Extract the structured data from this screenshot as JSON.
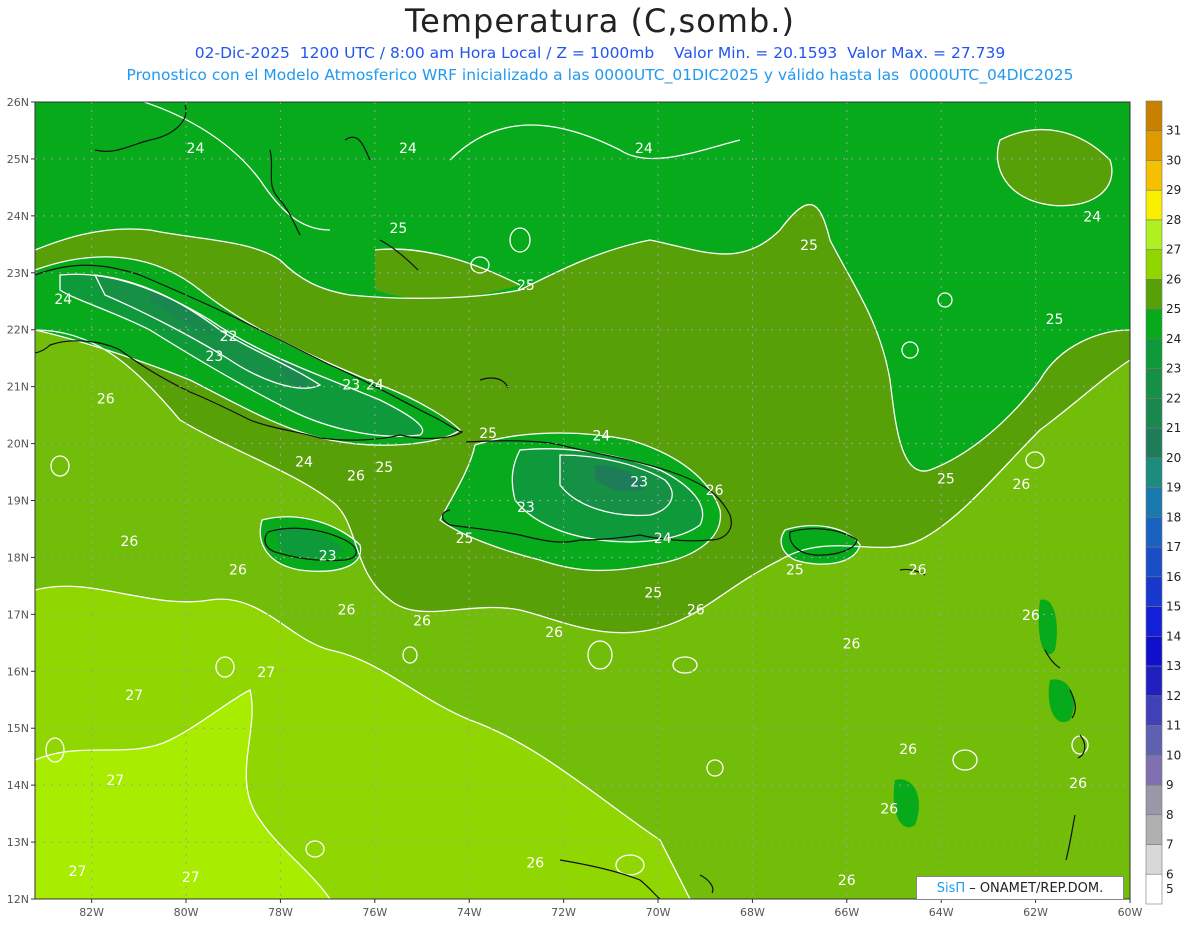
{
  "title": "Temperatura (C,somb.)",
  "subtitle_line1": "02-Dic-2025  1200 UTC / 8:00 am Hora Local / Z = 1000mb    Valor Min. = 20.1593  Valor Max. = 27.739",
  "subtitle_line2": "Pronostico con el Modelo Atmosferico WRF inicializado a las 0000UTC_01DIC2025 y válido hasta las  0000UTC_04DIC2025",
  "credit": {
    "brand": "SisΠ",
    "text": "– ONAMET/REP.DOM."
  },
  "map": {
    "lat_ticks": [
      "26N",
      "25N",
      "24N",
      "23N",
      "22N",
      "21N",
      "20N",
      "19N",
      "18N",
      "17N",
      "16N",
      "15N",
      "14N",
      "13N",
      "12N"
    ],
    "lon_ticks": [
      "82W",
      "80W",
      "78W",
      "76W",
      "74W",
      "72W",
      "70W",
      "68W",
      "66W",
      "64W",
      "62W",
      "60W"
    ],
    "lat_range": [
      12,
      26
    ],
    "lon_range": [
      -83.2,
      -60
    ],
    "colors": {
      "c24": "#06aa1a",
      "c25": "#58a008",
      "c26": "#72bc0a",
      "c27": "#90d600",
      "c28": "#a8ec00",
      "c23": "#0e9a3a",
      "c22": "#169044",
      "c21": "#1a884e",
      "c20": "#1e7c58",
      "contour": "#ffffff",
      "coast": "#111111",
      "grid": "#999999"
    },
    "contour_labels": [
      {
        "text": "24",
        "lat": 25.1,
        "lon": -79.8
      },
      {
        "text": "24",
        "lat": 25.1,
        "lon": -75.3
      },
      {
        "text": "24",
        "lat": 25.1,
        "lon": -70.3
      },
      {
        "text": "24",
        "lat": 23.9,
        "lon": -60.8
      },
      {
        "text": "24",
        "lat": 22.45,
        "lon": -82.6
      },
      {
        "text": "22",
        "lat": 21.8,
        "lon": -79.1
      },
      {
        "text": "23",
        "lat": 21.45,
        "lon": -79.4
      },
      {
        "text": "23",
        "lat": 20.95,
        "lon": -76.5
      },
      {
        "text": "24",
        "lat": 20.95,
        "lon": -76.0
      },
      {
        "text": "26",
        "lat": 20.7,
        "lon": -81.7
      },
      {
        "text": "25",
        "lat": 23.7,
        "lon": -75.5
      },
      {
        "text": "25",
        "lat": 22.7,
        "lon": -72.8
      },
      {
        "text": "25",
        "lat": 23.4,
        "lon": -66.8
      },
      {
        "text": "25",
        "lat": 22.1,
        "lon": -61.6
      },
      {
        "text": "24",
        "lat": 19.6,
        "lon": -77.5
      },
      {
        "text": "26",
        "lat": 19.35,
        "lon": -76.4
      },
      {
        "text": "25",
        "lat": 19.5,
        "lon": -75.8
      },
      {
        "text": "25",
        "lat": 20.1,
        "lon": -73.6
      },
      {
        "text": "24",
        "lat": 20.05,
        "lon": -71.2
      },
      {
        "text": "23",
        "lat": 18.8,
        "lon": -72.8
      },
      {
        "text": "23",
        "lat": 19.25,
        "lon": -70.4
      },
      {
        "text": "24",
        "lat": 18.25,
        "lon": -69.9
      },
      {
        "text": "25",
        "lat": 18.25,
        "lon": -74.1
      },
      {
        "text": "25",
        "lat": 17.3,
        "lon": -70.1
      },
      {
        "text": "26",
        "lat": 18.2,
        "lon": -81.2
      },
      {
        "text": "26",
        "lat": 17.7,
        "lon": -78.9
      },
      {
        "text": "23",
        "lat": 17.95,
        "lon": -77.0
      },
      {
        "text": "26",
        "lat": 17.0,
        "lon": -76.6
      },
      {
        "text": "26",
        "lat": 16.8,
        "lon": -75.0
      },
      {
        "text": "26",
        "lat": 16.6,
        "lon": -72.2
      },
      {
        "text": "26",
        "lat": 17.0,
        "lon": -69.2
      },
      {
        "text": "26",
        "lat": 16.4,
        "lon": -65.9
      },
      {
        "text": "26",
        "lat": 19.1,
        "lon": -68.8
      },
      {
        "text": "25",
        "lat": 17.7,
        "lon": -67.1
      },
      {
        "text": "26",
        "lat": 17.7,
        "lon": -64.5
      },
      {
        "text": "25",
        "lat": 19.3,
        "lon": -63.9
      },
      {
        "text": "26",
        "lat": 19.2,
        "lon": -62.3
      },
      {
        "text": "26",
        "lat": 16.9,
        "lon": -62.1
      },
      {
        "text": "27",
        "lat": 15.9,
        "lon": -78.3
      },
      {
        "text": "27",
        "lat": 15.5,
        "lon": -81.1
      },
      {
        "text": "27",
        "lat": 14.0,
        "lon": -81.5
      },
      {
        "text": "27",
        "lat": 12.3,
        "lon": -79.9
      },
      {
        "text": "27",
        "lat": 12.4,
        "lon": -82.3
      },
      {
        "text": "26",
        "lat": 12.55,
        "lon": -72.6
      },
      {
        "text": "26",
        "lat": 12.25,
        "lon": -66.0
      },
      {
        "text": "26",
        "lat": 14.55,
        "lon": -64.7
      },
      {
        "text": "26",
        "lat": 13.5,
        "lon": -65.1
      },
      {
        "text": "26",
        "lat": 13.95,
        "lon": -61.1
      }
    ]
  },
  "colorbar": {
    "labels": [
      "31",
      "30",
      "29",
      "28",
      "27",
      "26",
      "25",
      "24",
      "23",
      "22",
      "21",
      "20",
      "19",
      "18",
      "17",
      "16",
      "15",
      "14",
      "13",
      "12",
      "11",
      "10",
      "9",
      "8",
      "7",
      "6",
      "5"
    ],
    "colors": [
      "#c88000",
      "#e09a00",
      "#f4c000",
      "#f8f000",
      "#b0f020",
      "#90d600",
      "#58a008",
      "#06aa1a",
      "#0e9a3a",
      "#169044",
      "#1a884e",
      "#1e7c58",
      "#1c8c80",
      "#1a7ab0",
      "#1a62c0",
      "#1a4ec8",
      "#1838d0",
      "#1420d8",
      "#1010cc",
      "#2020c0",
      "#4040b8",
      "#6060b0",
      "#8070b0",
      "#9898a8",
      "#b0b0b0",
      "#d8d8d8",
      "#ffffff"
    ]
  }
}
